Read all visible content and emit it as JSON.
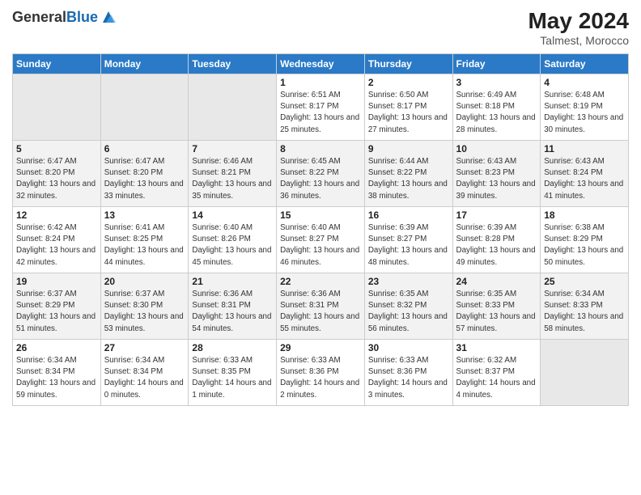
{
  "header": {
    "logo_general": "General",
    "logo_blue": "Blue",
    "month_year": "May 2024",
    "location": "Talmest, Morocco"
  },
  "weekdays": [
    "Sunday",
    "Monday",
    "Tuesday",
    "Wednesday",
    "Thursday",
    "Friday",
    "Saturday"
  ],
  "weeks": [
    [
      {
        "day": "",
        "sunrise": "",
        "sunset": "",
        "daylight": ""
      },
      {
        "day": "",
        "sunrise": "",
        "sunset": "",
        "daylight": ""
      },
      {
        "day": "",
        "sunrise": "",
        "sunset": "",
        "daylight": ""
      },
      {
        "day": "1",
        "sunrise": "Sunrise: 6:51 AM",
        "sunset": "Sunset: 8:17 PM",
        "daylight": "Daylight: 13 hours and 25 minutes."
      },
      {
        "day": "2",
        "sunrise": "Sunrise: 6:50 AM",
        "sunset": "Sunset: 8:17 PM",
        "daylight": "Daylight: 13 hours and 27 minutes."
      },
      {
        "day": "3",
        "sunrise": "Sunrise: 6:49 AM",
        "sunset": "Sunset: 8:18 PM",
        "daylight": "Daylight: 13 hours and 28 minutes."
      },
      {
        "day": "4",
        "sunrise": "Sunrise: 6:48 AM",
        "sunset": "Sunset: 8:19 PM",
        "daylight": "Daylight: 13 hours and 30 minutes."
      }
    ],
    [
      {
        "day": "5",
        "sunrise": "Sunrise: 6:47 AM",
        "sunset": "Sunset: 8:20 PM",
        "daylight": "Daylight: 13 hours and 32 minutes."
      },
      {
        "day": "6",
        "sunrise": "Sunrise: 6:47 AM",
        "sunset": "Sunset: 8:20 PM",
        "daylight": "Daylight: 13 hours and 33 minutes."
      },
      {
        "day": "7",
        "sunrise": "Sunrise: 6:46 AM",
        "sunset": "Sunset: 8:21 PM",
        "daylight": "Daylight: 13 hours and 35 minutes."
      },
      {
        "day": "8",
        "sunrise": "Sunrise: 6:45 AM",
        "sunset": "Sunset: 8:22 PM",
        "daylight": "Daylight: 13 hours and 36 minutes."
      },
      {
        "day": "9",
        "sunrise": "Sunrise: 6:44 AM",
        "sunset": "Sunset: 8:22 PM",
        "daylight": "Daylight: 13 hours and 38 minutes."
      },
      {
        "day": "10",
        "sunrise": "Sunrise: 6:43 AM",
        "sunset": "Sunset: 8:23 PM",
        "daylight": "Daylight: 13 hours and 39 minutes."
      },
      {
        "day": "11",
        "sunrise": "Sunrise: 6:43 AM",
        "sunset": "Sunset: 8:24 PM",
        "daylight": "Daylight: 13 hours and 41 minutes."
      }
    ],
    [
      {
        "day": "12",
        "sunrise": "Sunrise: 6:42 AM",
        "sunset": "Sunset: 8:24 PM",
        "daylight": "Daylight: 13 hours and 42 minutes."
      },
      {
        "day": "13",
        "sunrise": "Sunrise: 6:41 AM",
        "sunset": "Sunset: 8:25 PM",
        "daylight": "Daylight: 13 hours and 44 minutes."
      },
      {
        "day": "14",
        "sunrise": "Sunrise: 6:40 AM",
        "sunset": "Sunset: 8:26 PM",
        "daylight": "Daylight: 13 hours and 45 minutes."
      },
      {
        "day": "15",
        "sunrise": "Sunrise: 6:40 AM",
        "sunset": "Sunset: 8:27 PM",
        "daylight": "Daylight: 13 hours and 46 minutes."
      },
      {
        "day": "16",
        "sunrise": "Sunrise: 6:39 AM",
        "sunset": "Sunset: 8:27 PM",
        "daylight": "Daylight: 13 hours and 48 minutes."
      },
      {
        "day": "17",
        "sunrise": "Sunrise: 6:39 AM",
        "sunset": "Sunset: 8:28 PM",
        "daylight": "Daylight: 13 hours and 49 minutes."
      },
      {
        "day": "18",
        "sunrise": "Sunrise: 6:38 AM",
        "sunset": "Sunset: 8:29 PM",
        "daylight": "Daylight: 13 hours and 50 minutes."
      }
    ],
    [
      {
        "day": "19",
        "sunrise": "Sunrise: 6:37 AM",
        "sunset": "Sunset: 8:29 PM",
        "daylight": "Daylight: 13 hours and 51 minutes."
      },
      {
        "day": "20",
        "sunrise": "Sunrise: 6:37 AM",
        "sunset": "Sunset: 8:30 PM",
        "daylight": "Daylight: 13 hours and 53 minutes."
      },
      {
        "day": "21",
        "sunrise": "Sunrise: 6:36 AM",
        "sunset": "Sunset: 8:31 PM",
        "daylight": "Daylight: 13 hours and 54 minutes."
      },
      {
        "day": "22",
        "sunrise": "Sunrise: 6:36 AM",
        "sunset": "Sunset: 8:31 PM",
        "daylight": "Daylight: 13 hours and 55 minutes."
      },
      {
        "day": "23",
        "sunrise": "Sunrise: 6:35 AM",
        "sunset": "Sunset: 8:32 PM",
        "daylight": "Daylight: 13 hours and 56 minutes."
      },
      {
        "day": "24",
        "sunrise": "Sunrise: 6:35 AM",
        "sunset": "Sunset: 8:33 PM",
        "daylight": "Daylight: 13 hours and 57 minutes."
      },
      {
        "day": "25",
        "sunrise": "Sunrise: 6:34 AM",
        "sunset": "Sunset: 8:33 PM",
        "daylight": "Daylight: 13 hours and 58 minutes."
      }
    ],
    [
      {
        "day": "26",
        "sunrise": "Sunrise: 6:34 AM",
        "sunset": "Sunset: 8:34 PM",
        "daylight": "Daylight: 13 hours and 59 minutes."
      },
      {
        "day": "27",
        "sunrise": "Sunrise: 6:34 AM",
        "sunset": "Sunset: 8:34 PM",
        "daylight": "Daylight: 14 hours and 0 minutes."
      },
      {
        "day": "28",
        "sunrise": "Sunrise: 6:33 AM",
        "sunset": "Sunset: 8:35 PM",
        "daylight": "Daylight: 14 hours and 1 minute."
      },
      {
        "day": "29",
        "sunrise": "Sunrise: 6:33 AM",
        "sunset": "Sunset: 8:36 PM",
        "daylight": "Daylight: 14 hours and 2 minutes."
      },
      {
        "day": "30",
        "sunrise": "Sunrise: 6:33 AM",
        "sunset": "Sunset: 8:36 PM",
        "daylight": "Daylight: 14 hours and 3 minutes."
      },
      {
        "day": "31",
        "sunrise": "Sunrise: 6:32 AM",
        "sunset": "Sunset: 8:37 PM",
        "daylight": "Daylight: 14 hours and 4 minutes."
      },
      {
        "day": "",
        "sunrise": "",
        "sunset": "",
        "daylight": ""
      }
    ]
  ]
}
